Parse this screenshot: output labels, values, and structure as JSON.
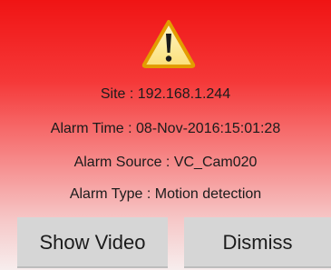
{
  "alarm": {
    "icon": "warning-triangle-icon",
    "site": "Site : 192.168.1.244",
    "alarm_time": "Alarm Time : 08-Nov-2016:15:01:28",
    "alarm_source": "Alarm Source : VC_Cam020",
    "alarm_type": "Alarm Type : Motion detection"
  },
  "actions": {
    "show_video_label": "Show Video",
    "dismiss_label": "Dismiss"
  },
  "colors": {
    "background_top": "#f01414",
    "background_bottom": "#f7eded",
    "button_background": "#d6d6d6",
    "warning_yellow": "#fbe27a",
    "warning_border": "#e0a400"
  }
}
